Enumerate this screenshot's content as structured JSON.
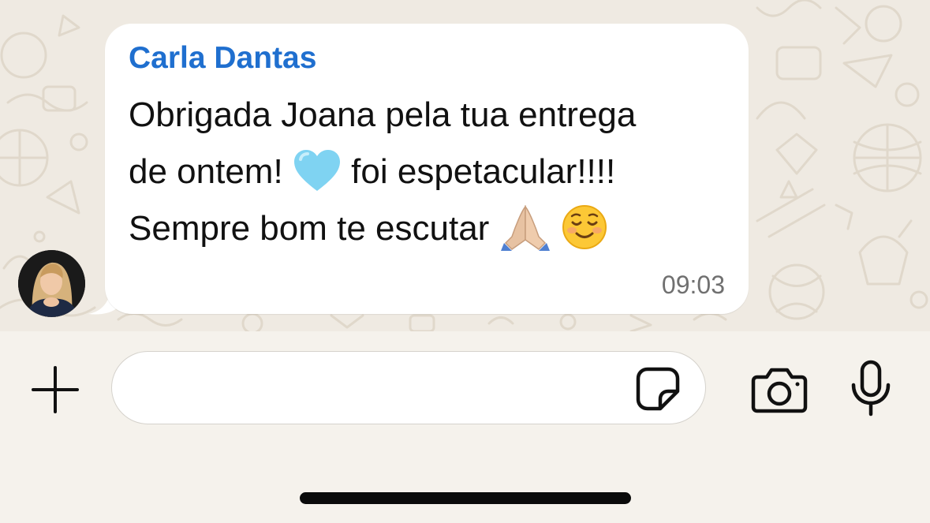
{
  "chat": {
    "message": {
      "sender": "Carla Dantas",
      "lines": [
        "Obrigada Joana pela tua entrega",
        "de ontem!",
        "foi espetacular!!!!",
        "Sempre bom te escutar"
      ],
      "emojis": [
        "light-blue-heart",
        "folded-hands",
        "smiling-face"
      ],
      "time": "09:03"
    },
    "colors": {
      "sender_name": "#1f6fcf",
      "bubble": "#ffffff",
      "wallpaper": "#efeae2"
    }
  },
  "composer": {
    "input_value": "",
    "icons": [
      "plus-icon",
      "sticker-icon",
      "camera-icon",
      "microphone-icon"
    ]
  }
}
